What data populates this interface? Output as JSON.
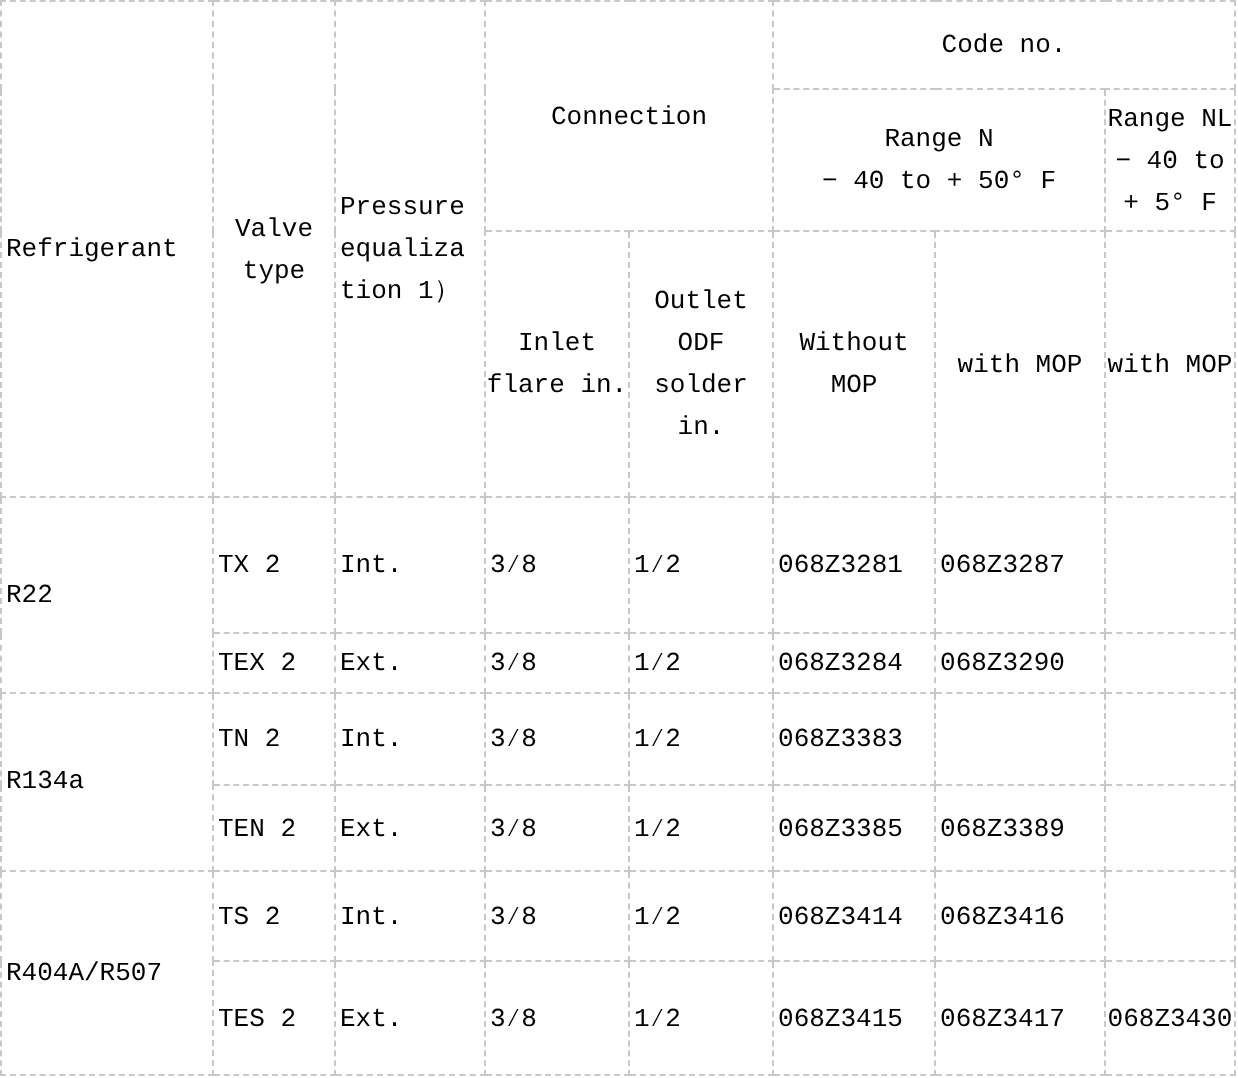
{
  "header": {
    "refrigerant": "Refrigerant",
    "valve_type": "Valve type",
    "pressure_equalization": "Pressure equalization 1）",
    "connection": "Connection",
    "inlet": "Inlet flare in.",
    "outlet": "Outlet ODF solder in.",
    "code_no": "Code no.",
    "range_n": [
      "Range N",
      "− 40 to + 50° F"
    ],
    "range_nl": [
      "Range NL",
      "− 40 to + 5° F"
    ],
    "without_mop": "Without MOP",
    "with_mop_n": "with MOP",
    "with_mop_nl": "with MOP"
  },
  "groups": [
    {
      "refrigerant": "R22",
      "rows": [
        [
          "TX 2",
          "Int.",
          "3⁄8",
          "1⁄2",
          "068Z3281",
          "068Z3287",
          ""
        ],
        [
          "TEX 2",
          "Ext.",
          "3⁄8",
          "1⁄2",
          "068Z3284",
          "068Z3290",
          ""
        ]
      ]
    },
    {
      "refrigerant": "R134a",
      "rows": [
        [
          "TN 2",
          "Int.",
          "3⁄8",
          "1⁄2",
          "068Z3383",
          "",
          ""
        ],
        [
          "TEN 2",
          "Ext.",
          "3⁄8",
          "1⁄2",
          "068Z3385",
          "068Z3389",
          ""
        ]
      ]
    },
    {
      "refrigerant": "R404A/R507",
      "rows": [
        [
          "TS 2",
          "Int.",
          "3⁄8",
          "1⁄2",
          "068Z3414",
          "068Z3416",
          ""
        ],
        [
          "TES 2",
          "Ext.",
          "3⁄8",
          "1⁄2",
          "068Z3415",
          "068Z3417",
          "068Z3430"
        ]
      ]
    }
  ]
}
